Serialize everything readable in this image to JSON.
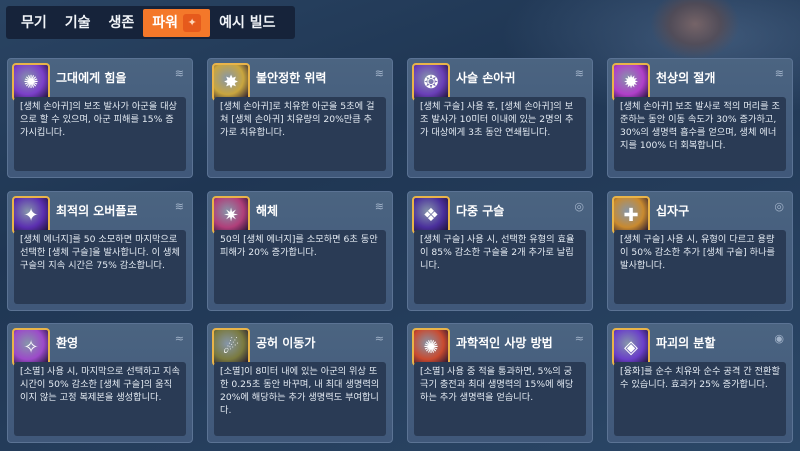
{
  "tabs": [
    {
      "label": "무기",
      "active": false
    },
    {
      "label": "기술",
      "active": false
    },
    {
      "label": "생존",
      "active": false
    },
    {
      "label": "파워",
      "active": true
    },
    {
      "label": "예시 빌드",
      "active": false
    }
  ],
  "cards": [
    {
      "title": "그대에게 힘을",
      "desc": "[생체 손아귀]의 보조 발사가 아군을 대상으로 할 수 있으며, 아군 피해를 15% 증가시킵니다.",
      "icon": "power-to-you-icon",
      "icon_color": "#7b3fc9",
      "badge_icon": "wing-badge-icon"
    },
    {
      "title": "불안정한 위력",
      "desc": "[생체 손아귀]로 치유한 아군을 5초에 걸쳐 [생체 손아귀] 치유량의 20%만큼 추가로 치유합니다.",
      "icon": "unstable-power-icon",
      "icon_color": "#c9a63f",
      "badge_icon": "wing-badge-icon"
    },
    {
      "title": "사슬 손아귀",
      "desc": "[생체 구슬] 사용 후, [생체 손아귀]의 보조 발사가 10미터 이내에 있는 2명의 추가 대상에게 3초 동안 연쇄됩니다.",
      "icon": "chain-grasp-icon",
      "icon_color": "#6a3fb8",
      "badge_icon": "wing-badge-icon"
    },
    {
      "title": "천상의 절개",
      "desc": "[생체 손아귀] 보조 발사로 적의 머리를 조준하는 동안 이동 속도가 30% 증가하고, 30%의 생명력 흡수를 얻으며, 생체 에너지를 100% 더 회복합니다.",
      "icon": "celestial-slash-icon",
      "icon_color": "#b03fc9",
      "badge_icon": "wing-badge-icon"
    },
    {
      "title": "최적의 오버플로",
      "desc": "[생체 에너지]를 50 소모하면 마지막으로 선택한 [생체 구슬]을 발사합니다. 이 생체 구슬의 지속 시간은 75% 감소합니다.",
      "icon": "optimal-overflow-icon",
      "icon_color": "#5b2fb0",
      "badge_icon": "wing-badge-icon"
    },
    {
      "title": "해체",
      "desc": "50의 [생체 에너지]를 소모하면 6초 동안 피해가 20% 증가합니다.",
      "icon": "dismantle-icon",
      "icon_color": "#b03f7a",
      "badge_icon": "wing-badge-icon"
    },
    {
      "title": "다중 구슬",
      "desc": "[생체 구슬] 사용 시, 선택한 유형의 효율이 85% 감소한 구슬을 2개 추가로 날립니다.",
      "icon": "multi-orb-icon",
      "icon_color": "#4a2f9c",
      "badge_icon": "orb-badge-icon"
    },
    {
      "title": "십자구",
      "desc": "[생체 구슬] 사용 시, 유형이 다르고 용량이 50% 감소한 추가 [생체 구슬] 하나를 발사합니다.",
      "icon": "cross-orb-icon",
      "icon_color": "#c98a2f",
      "badge_icon": "orb-badge-icon"
    },
    {
      "title": "환영",
      "desc": "[소멸] 사용 시, 마지막으로 선택하고 지속 시간이 50% 감소한 [생체 구슬]의 움직이지 않는 고정 복제본을 생성합니다.",
      "icon": "phantasm-icon",
      "icon_color": "#9c4ac9",
      "badge_icon": "fade-badge-icon"
    },
    {
      "title": "공허 이동가",
      "desc": "[소멸]이 8미터 내에 있는 아군의 위상 또한 0.25초 동안 바꾸며, 내 최대 생명력의 20%에 해당하는 추가 생명력도 부여합니다.",
      "icon": "void-walker-icon",
      "icon_color": "#7a7a3f",
      "badge_icon": "fade-badge-icon"
    },
    {
      "title": "과학적인 사망 방법",
      "desc": "[소멸] 사용 중 적을 통과하면, 5%의 궁극기 충전과 최대 생명력의 15%에 해당하는 추가 생명력을 얻습니다.",
      "icon": "scientific-deathodology-icon",
      "icon_color": "#c94a2f",
      "badge_icon": "fade-badge-icon"
    },
    {
      "title": "파괴의 분할",
      "desc": "[융화]를 순수 치유와 순수 공격 간 전환할 수 있습니다. 효과가 25% 증가합니다.",
      "icon": "destructive-division-icon",
      "icon_color": "#6a3fc9",
      "badge_icon": "coalescence-badge-icon"
    }
  ]
}
